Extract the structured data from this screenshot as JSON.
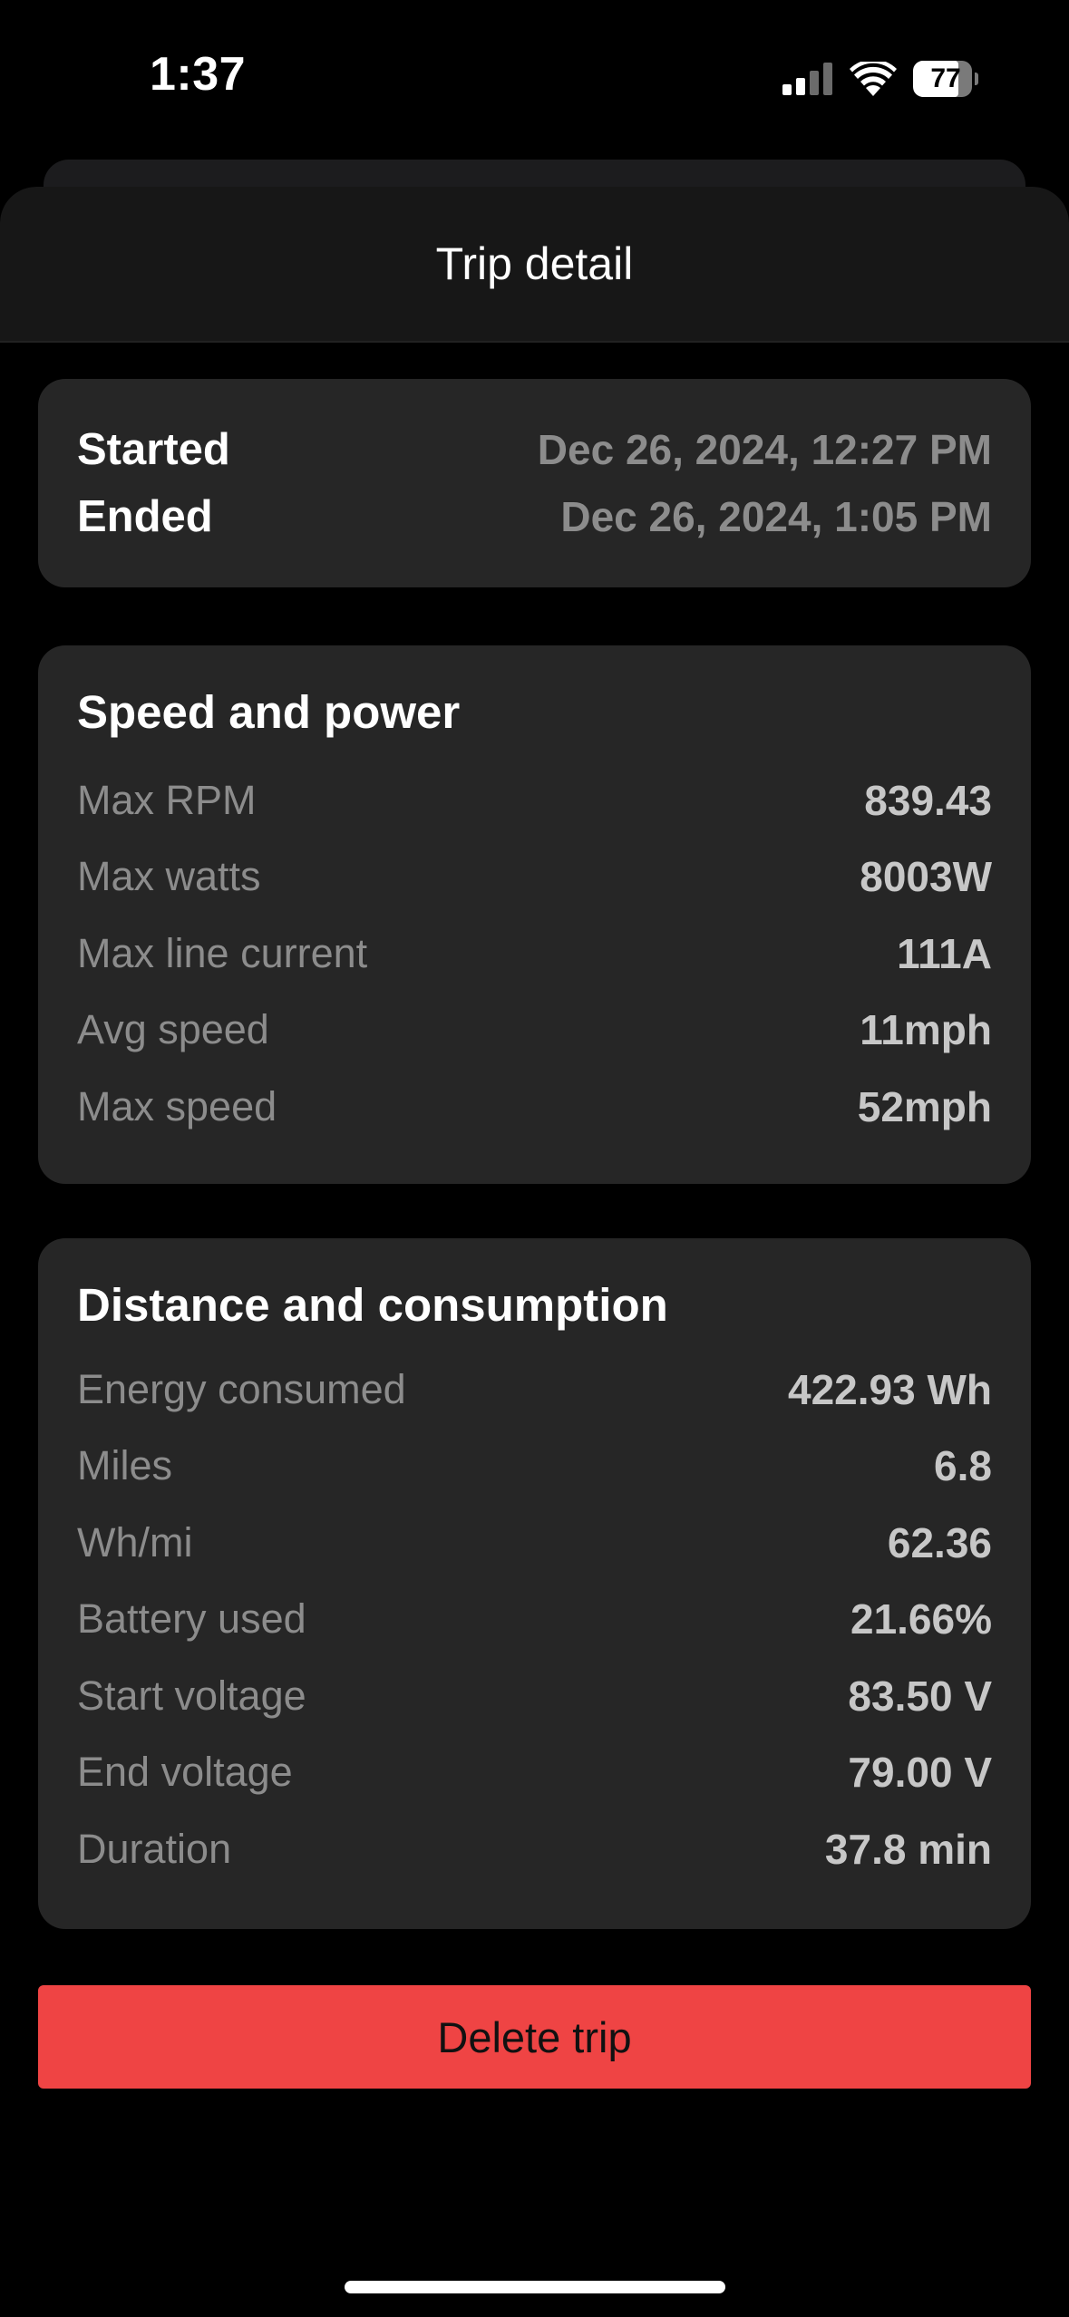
{
  "status_bar": {
    "time": "1:37",
    "battery_level": "77",
    "battery_fraction": 0.77,
    "icons": [
      "cellular-signal-icon",
      "wifi-icon",
      "battery-icon"
    ]
  },
  "header": {
    "title": "Trip detail"
  },
  "times": [
    {
      "label": "Started",
      "value": "Dec 26, 2024, 12:27 PM"
    },
    {
      "label": "Ended",
      "value": "Dec 26, 2024, 1:05 PM"
    }
  ],
  "speed_power": {
    "heading": "Speed and power",
    "rows": [
      {
        "label": "Max RPM",
        "value": "839.43"
      },
      {
        "label": "Max watts",
        "value": "8003W"
      },
      {
        "label": "Max line current",
        "value": "111A"
      },
      {
        "label": "Avg speed",
        "value": "11mph"
      },
      {
        "label": "Max speed",
        "value": "52mph"
      }
    ]
  },
  "distance_consumption": {
    "heading": "Distance and consumption",
    "rows": [
      {
        "label": "Energy consumed",
        "value": "422.93 Wh"
      },
      {
        "label": "Miles",
        "value": "6.8"
      },
      {
        "label": "Wh/mi",
        "value": "62.36"
      },
      {
        "label": "Battery used",
        "value": "21.66%"
      },
      {
        "label": "Start voltage",
        "value": "83.50 V"
      },
      {
        "label": "End voltage",
        "value": "79.00 V"
      },
      {
        "label": "Duration",
        "value": "37.8 min"
      }
    ]
  },
  "actions": {
    "delete_label": "Delete trip"
  },
  "colors": {
    "background": "#000000",
    "card": "#262626",
    "danger": "#ef4444",
    "muted_text": "#8c8c8c"
  }
}
